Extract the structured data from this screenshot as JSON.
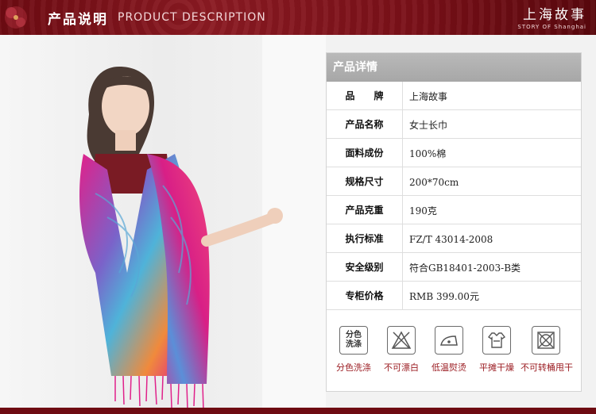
{
  "header": {
    "title_cn": "产品说明",
    "title_en": "PRODUCT DESCRIPTION",
    "brand_cn": "上海故事",
    "brand_en": "STORY OF  Shanghai"
  },
  "details": {
    "heading": "产品详情",
    "rows": [
      {
        "label": "品　　牌",
        "value": "上海故事"
      },
      {
        "label": "产品名称",
        "value": "女士长巾"
      },
      {
        "label": "面料成份",
        "value": "100%棉"
      },
      {
        "label": "规格尺寸",
        "value": "200*70cm"
      },
      {
        "label": "产品克重",
        "value": "190克"
      },
      {
        "label": "执行标准",
        "value": "FZ/T 43014-2008"
      },
      {
        "label": "安全级别",
        "value": "符合GB18401-2003-B类"
      },
      {
        "label": "专柜价格",
        "value": "RMB 399.00元"
      }
    ]
  },
  "care": [
    {
      "icon": "wash-separately-icon",
      "icon_text": "分色\n洗涤",
      "label": "分色洗涤"
    },
    {
      "icon": "no-bleach-icon",
      "label": "不可漂白"
    },
    {
      "icon": "low-iron-icon",
      "label": "低温熨烫"
    },
    {
      "icon": "flat-dry-icon",
      "label": "平摊干燥"
    },
    {
      "icon": "no-tumble-dry-icon",
      "label": "不可转桶甩干"
    }
  ],
  "colors": {
    "header": "#7a1018",
    "accent": "#9b1c22",
    "scarf_pink": "#e0218a",
    "scarf_blue": "#5aa7d6"
  }
}
